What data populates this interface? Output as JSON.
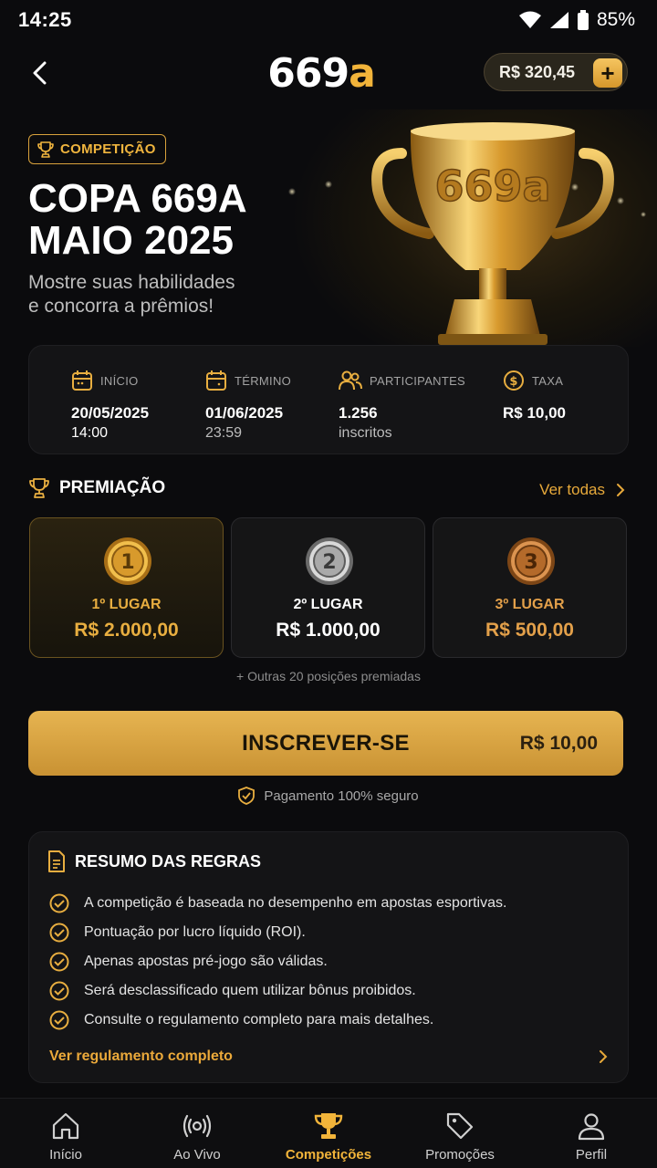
{
  "status_bar": {
    "time": "14:25",
    "battery": "85%"
  },
  "header": {
    "logo_main": "669",
    "logo_accent": "a",
    "balance": "R$ 320,45",
    "add_label": "+"
  },
  "hero": {
    "badge": "COMPETIÇÃO",
    "title_line1": "COPA 669A",
    "title_line2": "MAIO 2025",
    "subtitle_line1": "Mostre suas habilidades",
    "subtitle_line2": "e concorra a prêmios!",
    "trophy_text": "669a"
  },
  "info": {
    "start": {
      "label": "INÍCIO",
      "value": "20/05/2025",
      "sub": "14:00"
    },
    "end": {
      "label": "TÉRMINO",
      "value": "01/06/2025",
      "sub": "23:59"
    },
    "participants": {
      "label": "PARTICIPANTES",
      "value": "1.256",
      "sub": "inscritos"
    },
    "fee": {
      "label": "TAXA",
      "value": "R$ 10,00"
    }
  },
  "prizes": {
    "title": "PREMIAÇÃO",
    "see_all": "Ver todas",
    "items": [
      {
        "num": "1",
        "position": "1º LUGAR",
        "value": "R$ 2.000,00",
        "color": "#e8ae40"
      },
      {
        "num": "2",
        "position": "2º LUGAR",
        "value": "R$ 1.000,00",
        "color": "#ffffff"
      },
      {
        "num": "3",
        "position": "3º LUGAR",
        "value": "R$ 500,00",
        "color": "#e3a04a"
      }
    ],
    "others": "+ Outras 20 posições premiadas"
  },
  "subscribe": {
    "label": "INSCREVER-SE",
    "price": "R$ 10,00"
  },
  "secure_note": "Pagamento 100% seguro",
  "rules": {
    "title": "RESUMO DAS REGRAS",
    "items": [
      "A competição é baseada no desempenho em apostas esportivas.",
      "Pontuação por lucro líquido (ROI).",
      "Apenas apostas pré-jogo são válidas.",
      "Será desclassificado quem utilizar bônus proibidos.",
      "Consulte o regulamento completo para mais detalhes."
    ],
    "link": "Ver regulamento completo"
  },
  "nav": {
    "items": [
      {
        "label": "Início",
        "icon": "home-icon"
      },
      {
        "label": "Ao Vivo",
        "icon": "live-icon"
      },
      {
        "label": "Competições",
        "icon": "trophy-icon"
      },
      {
        "label": "Promoções",
        "icon": "tag-icon"
      },
      {
        "label": "Perfil",
        "icon": "user-icon"
      }
    ],
    "active": "Competições"
  },
  "colors": {
    "accent": "#f2b43a",
    "background": "#0b0b0d",
    "card": "#141416"
  }
}
